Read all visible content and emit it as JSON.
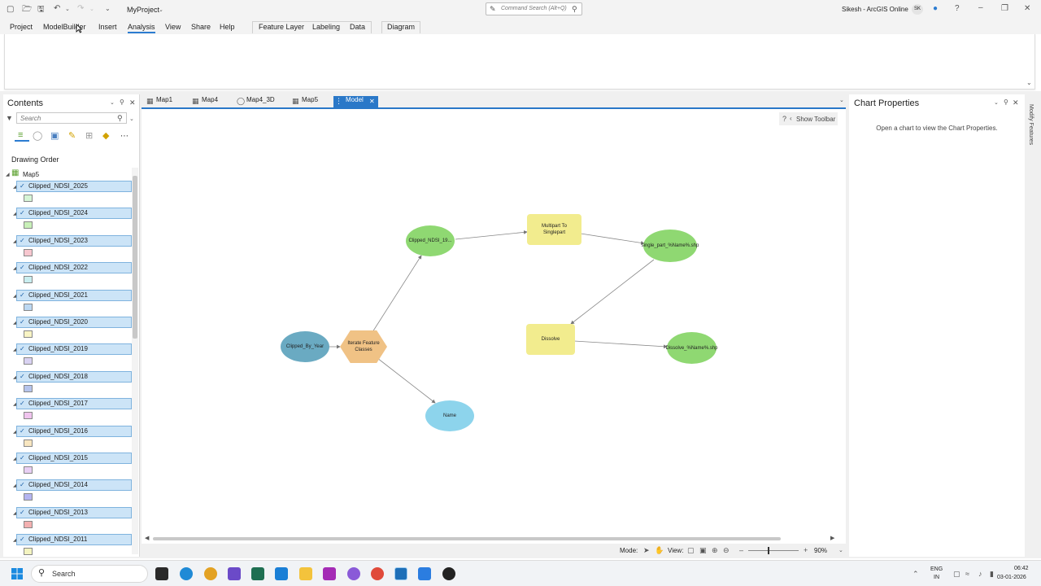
{
  "window": {
    "project_name": "MyProject",
    "command_search_placeholder": "Command Search (Alt+Q)",
    "user": "Sikesh - ArcGIS Online",
    "user_initials": "SK"
  },
  "ribbon": {
    "tabs": [
      "Project",
      "ModelBuilder",
      "Insert",
      "Analysis",
      "View",
      "Share",
      "Help",
      "Feature Layer",
      "Labeling",
      "Data",
      "Diagram"
    ],
    "active_tab": "Analysis"
  },
  "contents": {
    "title": "Contents",
    "search_placeholder": "Search",
    "drawing_order_label": "Drawing Order",
    "map_name": "Map5",
    "layers": [
      {
        "name": "Clipped_NDSI_2025",
        "color": "#d6f5d6"
      },
      {
        "name": "Clipped_NDSI_2024",
        "color": "#c8f0b8"
      },
      {
        "name": "Clipped_NDSI_2023",
        "color": "#f7c7cf"
      },
      {
        "name": "Clipped_NDSI_2022",
        "color": "#c9eef0"
      },
      {
        "name": "Clipped_NDSI_2021",
        "color": "#bcd8f2"
      },
      {
        "name": "Clipped_NDSI_2020",
        "color": "#f8f4c4"
      },
      {
        "name": "Clipped_NDSI_2019",
        "color": "#d9d2f2"
      },
      {
        "name": "Clipped_NDSI_2018",
        "color": "#b5c4ec"
      },
      {
        "name": "Clipped_NDSI_2017",
        "color": "#f0c4ee"
      },
      {
        "name": "Clipped_NDSI_2016",
        "color": "#f8e6c0"
      },
      {
        "name": "Clipped_NDSI_2015",
        "color": "#e8cff4"
      },
      {
        "name": "Clipped_NDSI_2014",
        "color": "#b4b4f0"
      },
      {
        "name": "Clipped_NDSI_2013",
        "color": "#f3b0b0"
      },
      {
        "name": "Clipped_NDSI_2011",
        "color": "#f4f4c0"
      }
    ]
  },
  "doc_tabs": [
    {
      "label": "Map1"
    },
    {
      "label": "Map4"
    },
    {
      "label": "Map4_3D"
    },
    {
      "label": "Map5"
    },
    {
      "label": "Model",
      "active": true
    }
  ],
  "canvas": {
    "show_toolbar_label": "Show Toolbar",
    "nodes": {
      "clipped_by_year": "Clipped_By_Year",
      "iterate": "Iterate Feature Classes",
      "clipped_ndsi": "Clipped_NDSI_19...",
      "name": "Name",
      "multipart": "Multipart To Singlepart",
      "single_part": "single_part_%Name%.shp",
      "dissolve": "Dissolve",
      "dissolve_out": "Dissolve_%Name%.shp"
    }
  },
  "chart_properties": {
    "title": "Chart Properties",
    "message": "Open a chart to view the Chart Properties.",
    "side_tab": "Modify Features"
  },
  "statusbar": {
    "mode_label": "Mode:",
    "view_label": "View:",
    "zoom": "90%"
  },
  "taskbar": {
    "search_label": "Search",
    "lang": "ENG",
    "region": "IN",
    "time": "06:42",
    "date": "03-01-2026"
  }
}
